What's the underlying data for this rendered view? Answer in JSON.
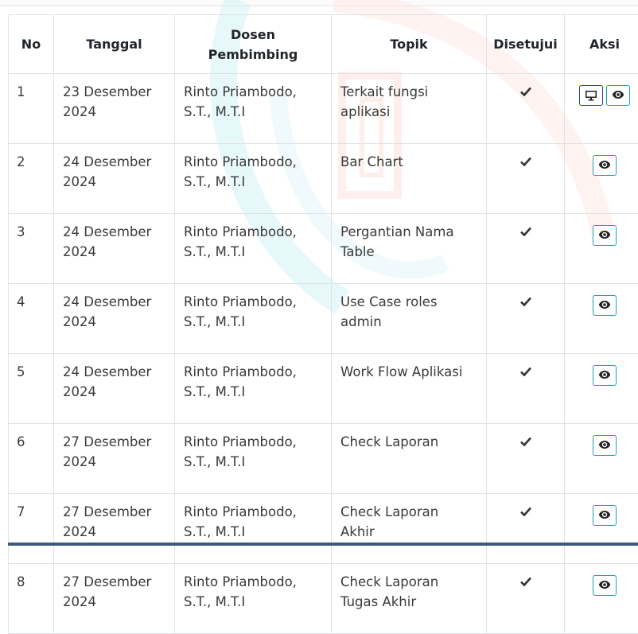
{
  "table": {
    "headers": {
      "no": "No",
      "tanggal": "Tanggal",
      "dosen_line1": "Dosen",
      "dosen_line2": "Pembimbing",
      "topik": "Topik",
      "disetujui": "Disetujui",
      "aksi": "Aksi"
    },
    "rows": [
      {
        "no": "1",
        "tanggal_1": "23 Desember",
        "tanggal_2": "2024",
        "dosen_1": "Rinto Priambodo,",
        "dosen_2": "S.T., M.T.I",
        "topik_1": "Terkait fungsi",
        "topik_2": "aplikasi",
        "approved": true,
        "actions": [
          "monitor-icon",
          "eye-icon"
        ]
      },
      {
        "no": "2",
        "tanggal_1": "24 Desember",
        "tanggal_2": "2024",
        "dosen_1": "Rinto Priambodo,",
        "dosen_2": "S.T., M.T.I",
        "topik_1": "Bar Chart",
        "topik_2": "",
        "approved": true,
        "actions": [
          "eye-icon"
        ]
      },
      {
        "no": "3",
        "tanggal_1": "24 Desember",
        "tanggal_2": "2024",
        "dosen_1": "Rinto Priambodo,",
        "dosen_2": "S.T., M.T.I",
        "topik_1": "Pergantian Nama",
        "topik_2": "Table",
        "approved": true,
        "actions": [
          "eye-icon"
        ]
      },
      {
        "no": "4",
        "tanggal_1": "24 Desember",
        "tanggal_2": "2024",
        "dosen_1": "Rinto Priambodo,",
        "dosen_2": "S.T., M.T.I",
        "topik_1": "Use Case roles",
        "topik_2": "admin",
        "approved": true,
        "actions": [
          "eye-icon"
        ]
      },
      {
        "no": "5",
        "tanggal_1": "24 Desember",
        "tanggal_2": "2024",
        "dosen_1": "Rinto Priambodo,",
        "dosen_2": "S.T., M.T.I",
        "topik_1": "Work Flow Aplikasi",
        "topik_2": "",
        "approved": true,
        "actions": [
          "eye-icon"
        ]
      },
      {
        "no": "6",
        "tanggal_1": "27 Desember",
        "tanggal_2": "2024",
        "dosen_1": "Rinto Priambodo,",
        "dosen_2": "S.T., M.T.I",
        "topik_1": "Check Laporan",
        "topik_2": "",
        "approved": true,
        "actions": [
          "eye-icon"
        ]
      },
      {
        "no": "7",
        "tanggal_1": "27 Desember",
        "tanggal_2": "2024",
        "dosen_1": "Rinto Priambodo,",
        "dosen_2": "S.T., M.T.I",
        "topik_1": "Check Laporan",
        "topik_2": "Akhir",
        "approved": true,
        "actions": [
          "eye-icon"
        ]
      },
      {
        "no": "8",
        "tanggal_1": "27 Desember",
        "tanggal_2": "2024",
        "dosen_1": "Rinto Priambodo,",
        "dosen_2": "S.T., M.T.I",
        "topik_1": "Check Laporan",
        "topik_2": "Tugas Akhir",
        "approved": true,
        "actions": [
          "eye-icon"
        ]
      }
    ]
  },
  "colors": {
    "border": "#dee2e6",
    "info_button_border": "#17a2b8",
    "primary_button_border": "#2b3ea8",
    "footer_bar": "#3c5a78"
  }
}
